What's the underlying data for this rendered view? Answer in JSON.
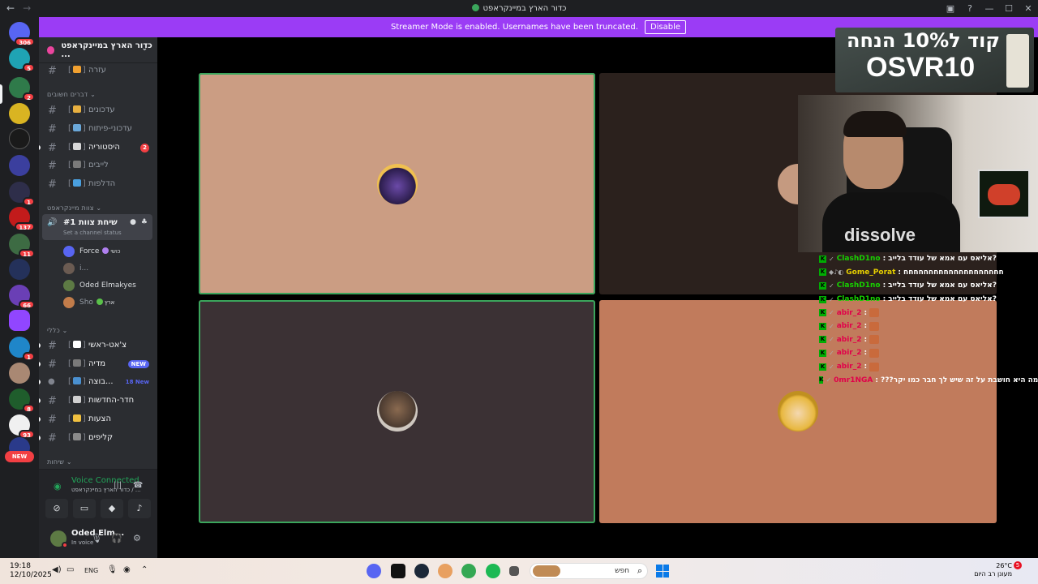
{
  "window": {
    "title": "כדור הארץ במיינקראפט"
  },
  "banner": {
    "text": "Streamer Mode is enabled. Usernames have been truncated.",
    "disable_label": "Disable"
  },
  "server_rail": {
    "badges": [
      "306",
      "5",
      "2",
      "1",
      "137",
      "11",
      "66",
      "1",
      "8",
      "93",
      "1"
    ],
    "new_label": "NEW"
  },
  "sidebar": {
    "guild_name": "כדור הארץ במיינקראפט ...",
    "categories": {
      "important": "דברים חשובים",
      "minecraft_team": "צוות מיינקראפט",
      "general": "כללי",
      "conversations": "שיחות"
    },
    "channels": {
      "help": "עזרה",
      "updates": "עדכונים",
      "dev_updates": "עדכוני-פיתוח",
      "history": "היסטוריה",
      "history_badge": "2",
      "lives": "לייבים",
      "leaks": "הדלפות",
      "main_chat": "צ'אט-ראשי",
      "media": "מדיה",
      "media_badge": "NEW",
      "group": "בוצה...",
      "group_badge": "18 New",
      "news_room": "חדר-החדשות",
      "suggestions": "הצעות",
      "clips": "קליפים"
    },
    "voice_channel": {
      "name": "שיחת צוות #1",
      "status": "Set a channel status"
    },
    "members": [
      {
        "name": "Force",
        "tag": "כושי",
        "color": "#5865f2"
      },
      {
        "name": "i...",
        "tag": "",
        "color": "#6b5b52"
      },
      {
        "name": "Oded Elmakyes",
        "tag": "",
        "color": "#5d7a44"
      },
      {
        "name": "Sho",
        "tag": "ארץ",
        "color": "#c27c4a"
      }
    ]
  },
  "voice_panel": {
    "title": "Voice Connected",
    "subtitle": "כדור הארץ במיינקראפט / ...",
    "icons": [
      "camera-off-icon",
      "screen-share-icon",
      "activity-icon",
      "soundboard-icon"
    ]
  },
  "user_panel": {
    "name": "Oded Elm...",
    "status": "In voice"
  },
  "stream": {
    "promo_line1": "קוד ל10% הנחה",
    "promo_line2": "OSVR10",
    "shirt_text": "dissolve"
  },
  "chat": [
    {
      "user": "ClashD1no",
      "color": "#17d100",
      "text": "אליאס עם אמא של עודד בלייב?"
    },
    {
      "user": "Gome_Porat",
      "color": "#e7d000",
      "text": "חחחחחחחחחחחחחחחחחחחח"
    },
    {
      "user": "ClashD1no",
      "color": "#17d100",
      "text": "אליאס עם אמא של עודד בלייב?"
    },
    {
      "user": "ClashD1no",
      "color": "#17d100",
      "text": "אליאס עם אמא של עודד בלייב?"
    },
    {
      "user": "abir_2",
      "color": "#e1004a",
      "text": ""
    },
    {
      "user": "abir_2",
      "color": "#e1004a",
      "text": ""
    },
    {
      "user": "abir_2",
      "color": "#e1004a",
      "text": ""
    },
    {
      "user": "abir_2",
      "color": "#e1004a",
      "text": ""
    },
    {
      "user": "abir_2",
      "color": "#e1004a",
      "text": ""
    },
    {
      "user": "0mr1NGA",
      "color": "#e1004a",
      "text": "???מה היא חושבת על זה שיש לך חבר כמו יקר"
    }
  ],
  "taskbar": {
    "time": "19:18",
    "date": "12/10/2025",
    "lang": "ENG",
    "search_placeholder": "חפש",
    "temperature": "26°C",
    "weather": "מעונן רב היום",
    "weather_badge": "5"
  }
}
